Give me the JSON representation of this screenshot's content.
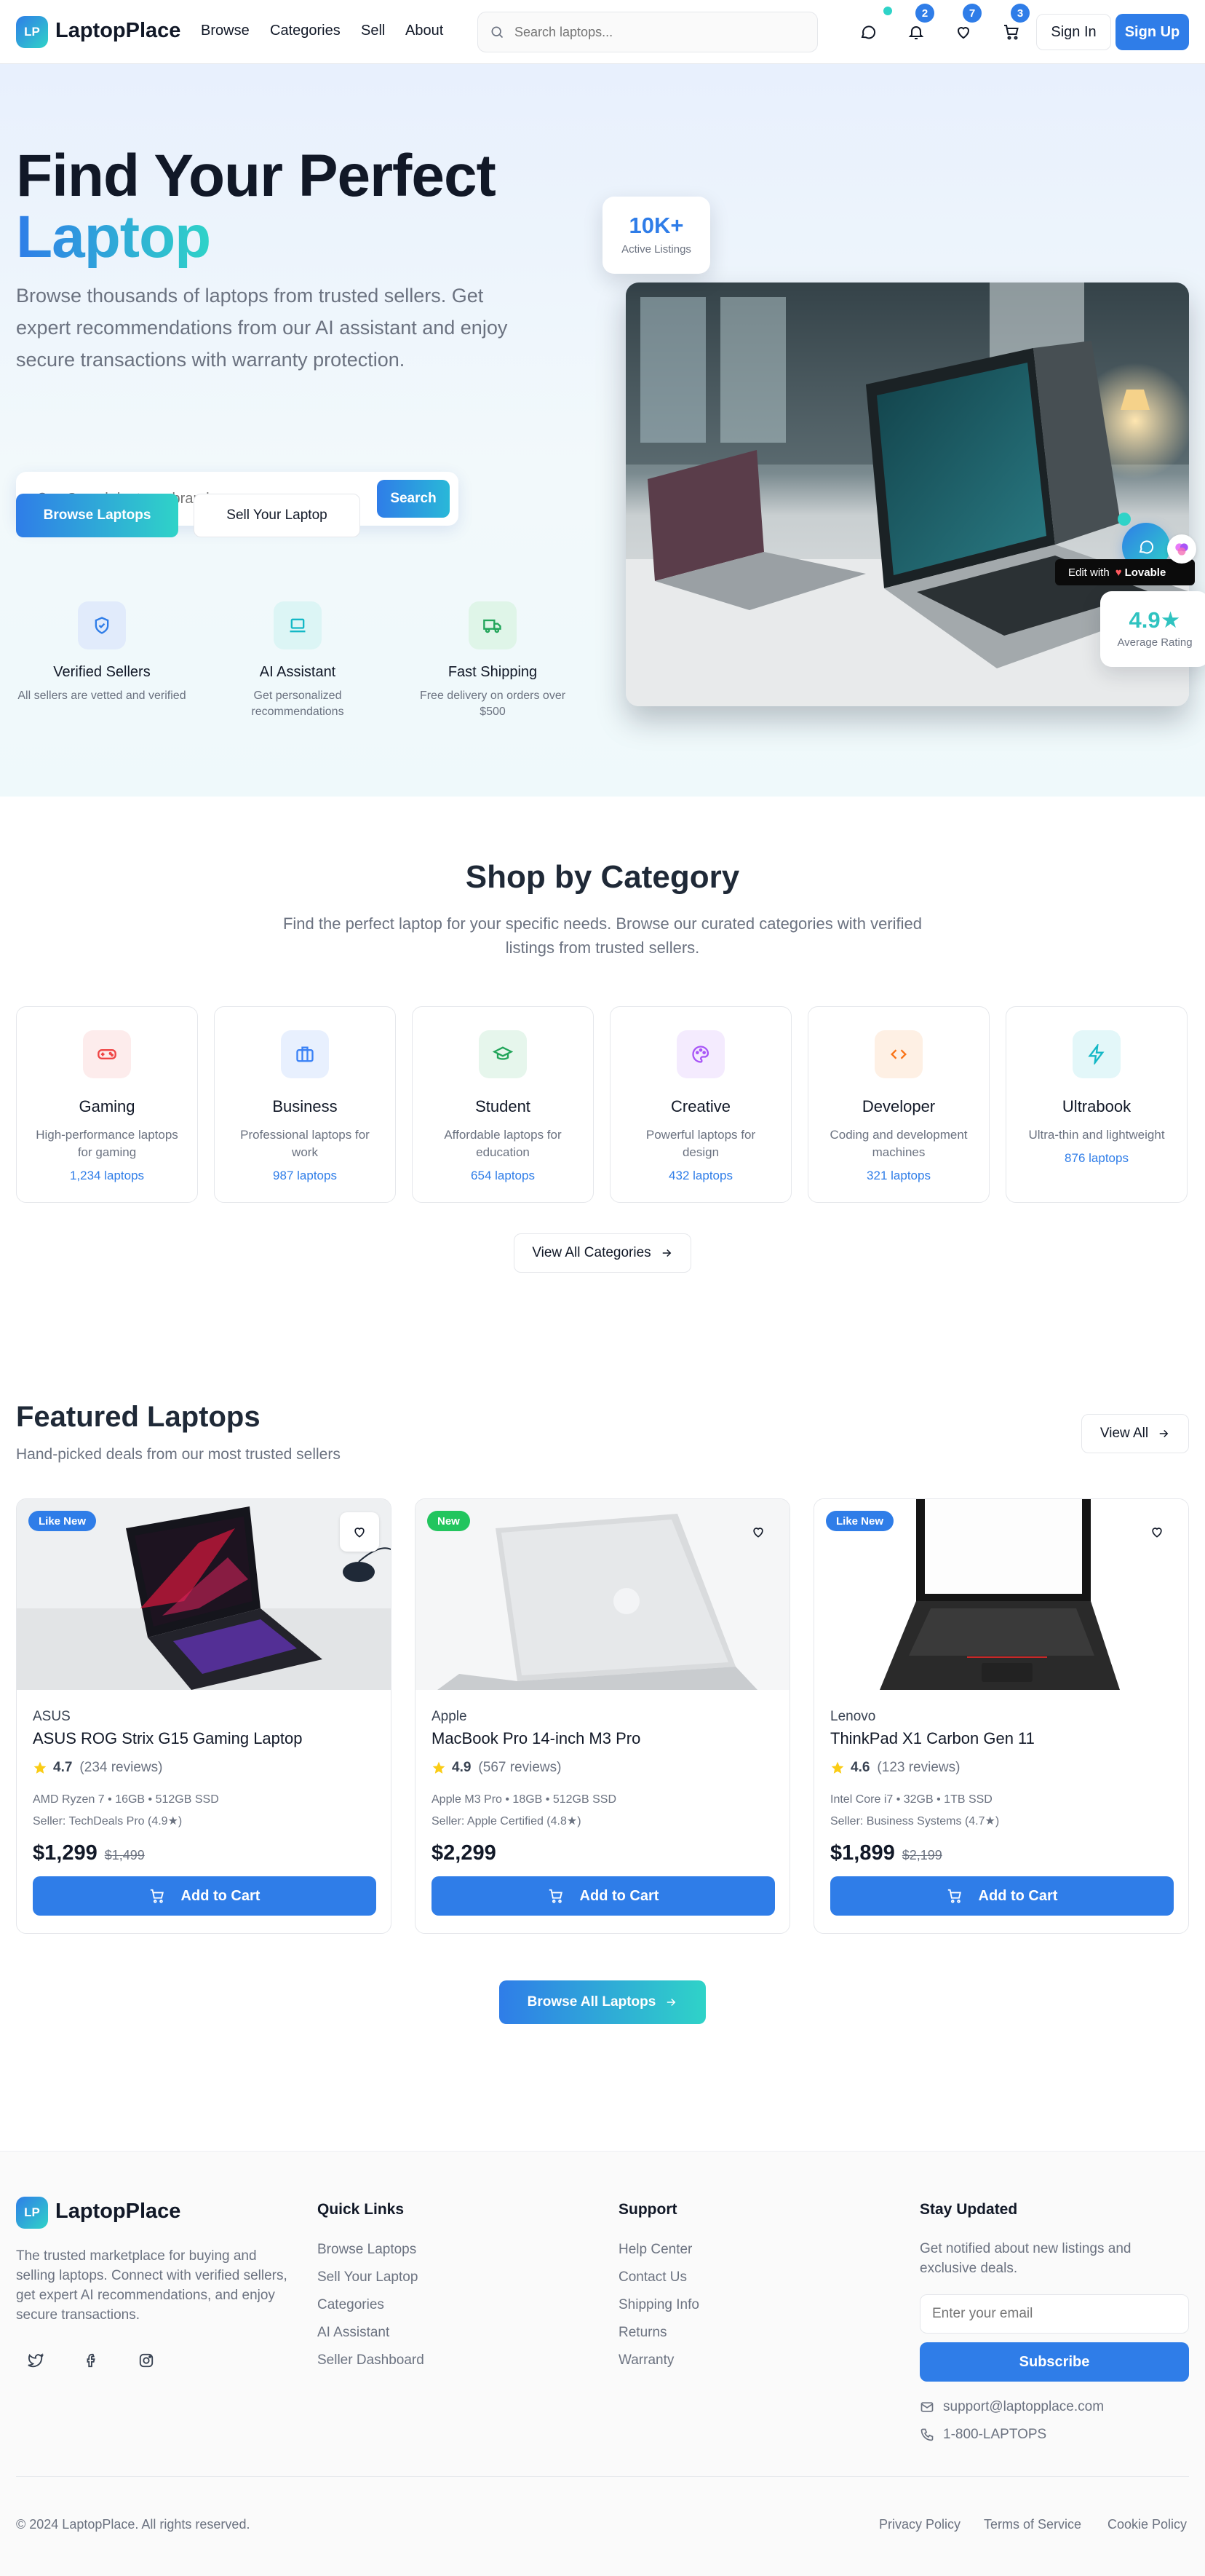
{
  "header": {
    "logo_badge": "LP",
    "logo_text": "LaptopPlace",
    "nav": [
      "Browse",
      "Categories",
      "Sell",
      "About"
    ],
    "search_placeholder": "Search laptops...",
    "badges": {
      "notifications": "2",
      "wishlist": "7",
      "cart": "3"
    },
    "sign_in": "Sign In",
    "sign_up": "Sign Up"
  },
  "hero": {
    "title_line1": "Find Your Perfect",
    "title_line2": "Laptop",
    "subtitle": "Browse thousands of laptops from trusted sellers. Get expert recommendations from our AI assistant and enjoy secure transactions with warranty protection.",
    "search_placeholder": "Search laptops, brands, specs...",
    "search_button": "Search",
    "browse_button": "Browse Laptops",
    "sell_button": "Sell Your Laptop",
    "features": [
      {
        "icon": "shield-icon",
        "title": "Verified Sellers",
        "desc": "All sellers are vetted and verified"
      },
      {
        "icon": "laptop-icon",
        "title": "AI Assistant",
        "desc": "Get personalized recommendations"
      },
      {
        "icon": "truck-icon",
        "title": "Fast Shipping",
        "desc": "Free delivery on orders over $500"
      }
    ],
    "stat_listings": {
      "value": "10K+",
      "label": "Active Listings"
    },
    "stat_rating": {
      "value": "4.9★",
      "label": "Average Rating"
    },
    "edit_with": "Edit with",
    "lovable": "Lovable"
  },
  "categories": {
    "title": "Shop by Category",
    "subtitle": "Find the perfect laptop for your specific needs. Browse our curated categories with verified listings from trusted sellers.",
    "items": [
      {
        "name": "Gaming",
        "desc": "High-performance laptops for gaming",
        "count": "1,234 laptops",
        "icon": "gamepad-icon",
        "color": "#ef4444",
        "bg": "#fdecec"
      },
      {
        "name": "Business",
        "desc": "Professional laptops for work",
        "count": "987 laptops",
        "icon": "briefcase-icon",
        "color": "#3b82f6",
        "bg": "#e8f0fe"
      },
      {
        "name": "Student",
        "desc": "Affordable laptops for education",
        "count": "654 laptops",
        "icon": "graduation-cap-icon",
        "color": "#22a55a",
        "bg": "#e6f6ec"
      },
      {
        "name": "Creative",
        "desc": "Powerful laptops for design",
        "count": "432 laptops",
        "icon": "palette-icon",
        "color": "#a855f7",
        "bg": "#f4ebfe"
      },
      {
        "name": "Developer",
        "desc": "Coding and development machines",
        "count": "321 laptops",
        "icon": "code-icon",
        "color": "#f97316",
        "bg": "#fef0e4"
      },
      {
        "name": "Ultrabook",
        "desc": "Ultra-thin and lightweight",
        "count": "876 laptops",
        "icon": "zap-icon",
        "color": "#14b8c6",
        "bg": "#e3f7f9"
      }
    ],
    "view_all": "View All Categories"
  },
  "featured": {
    "title": "Featured Laptops",
    "subtitle": "Hand-picked deals from our most trusted sellers",
    "view_all": "View All",
    "cards": [
      {
        "badge": "Like New",
        "badge_color": "#2f7de8",
        "brand": "ASUS",
        "name": "ASUS ROG Strix G15 Gaming Laptop",
        "rating": "4.7",
        "reviews": "(234 reviews)",
        "specs": "AMD Ryzen 7 • 16GB • 512GB SSD",
        "seller": "Seller: TechDeals Pro (4.9★)",
        "price": "$1,299",
        "old_price": "$1,499",
        "cta": "Add to Cart"
      },
      {
        "badge": "New",
        "badge_color": "#22c55e",
        "brand": "Apple",
        "name": "MacBook Pro 14-inch M3 Pro",
        "rating": "4.9",
        "reviews": "(567 reviews)",
        "specs": "Apple M3 Pro • 18GB • 512GB SSD",
        "seller": "Seller: Apple Certified (4.8★)",
        "price": "$2,299",
        "old_price": "",
        "cta": "Add to Cart"
      },
      {
        "badge": "Like New",
        "badge_color": "#2f7de8",
        "brand": "Lenovo",
        "name": "ThinkPad X1 Carbon Gen 11",
        "rating": "4.6",
        "reviews": "(123 reviews)",
        "specs": "Intel Core i7 • 32GB • 1TB SSD",
        "seller": "Seller: Business Systems (4.7★)",
        "price": "$1,899",
        "old_price": "$2,199",
        "cta": "Add to Cart"
      }
    ],
    "browse_all": "Browse All Laptops"
  },
  "footer": {
    "logo_badge": "LP",
    "logo_text": "LaptopPlace",
    "about": "The trusted marketplace for buying and selling laptops. Connect with verified sellers, get expert AI recommendations, and enjoy secure transactions.",
    "quick_links_title": "Quick Links",
    "quick_links": [
      "Browse Laptops",
      "Sell Your Laptop",
      "Categories",
      "AI Assistant",
      "Seller Dashboard"
    ],
    "support_title": "Support",
    "support_links": [
      "Help Center",
      "Contact Us",
      "Shipping Info",
      "Returns",
      "Warranty"
    ],
    "newsletter_title": "Stay Updated",
    "newsletter_text": "Get notified about new listings and exclusive deals.",
    "email_placeholder": "Enter your email",
    "subscribe": "Subscribe",
    "contact_email": "support@laptopplace.com",
    "contact_phone": "1-800-LAPTOPS",
    "copyright": "© 2024 LaptopPlace. All rights reserved.",
    "legal": [
      "Privacy Policy",
      "Terms of Service",
      "Cookie Policy"
    ]
  }
}
